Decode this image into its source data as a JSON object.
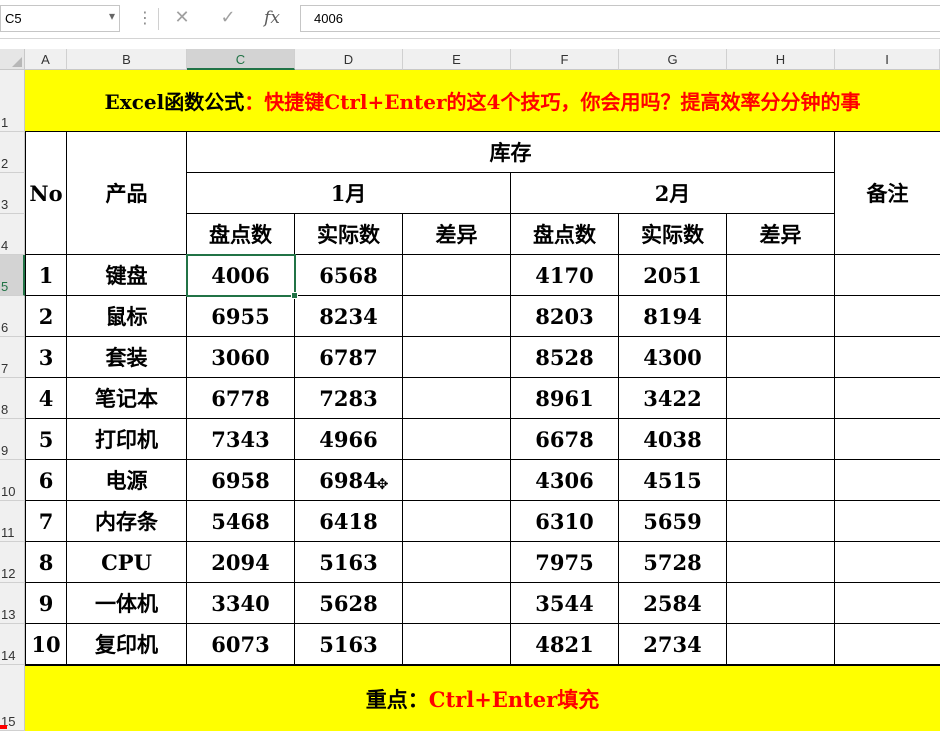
{
  "formula_bar": {
    "name_box": "C5",
    "cancel_icon": "✕",
    "confirm_icon": "✓",
    "fx_label": "fx",
    "formula_value": "4006"
  },
  "columns": [
    "A",
    "B",
    "C",
    "D",
    "E",
    "F",
    "G",
    "H",
    "I"
  ],
  "rows": [
    "1",
    "2",
    "3",
    "4",
    "5",
    "6",
    "7",
    "8",
    "9",
    "10",
    "11",
    "12",
    "13",
    "14",
    "15"
  ],
  "selected_column": "C",
  "selected_row": "5",
  "sheet": {
    "title_black": "Excel函数公式",
    "title_red": "：快捷键Ctrl+Enter的这4个技巧，你会用吗？提高效率分分钟的事",
    "header": {
      "no": "No",
      "product": "产品",
      "stock": "库存",
      "month1": "1月",
      "month2": "2月",
      "remark": "备注",
      "count": "盘点数",
      "actual": "实际数",
      "diff": "差异"
    },
    "records": [
      {
        "no": "1",
        "product": "键盘",
        "c1": "4006",
        "a1": "6568",
        "c2": "4170",
        "a2": "2051"
      },
      {
        "no": "2",
        "product": "鼠标",
        "c1": "6955",
        "a1": "8234",
        "c2": "8203",
        "a2": "8194"
      },
      {
        "no": "3",
        "product": "套装",
        "c1": "3060",
        "a1": "6787",
        "c2": "8528",
        "a2": "4300"
      },
      {
        "no": "4",
        "product": "笔记本",
        "c1": "6778",
        "a1": "7283",
        "c2": "8961",
        "a2": "3422"
      },
      {
        "no": "5",
        "product": "打印机",
        "c1": "7343",
        "a1": "4966",
        "c2": "6678",
        "a2": "4038"
      },
      {
        "no": "6",
        "product": "电源",
        "c1": "6958",
        "a1": "6984",
        "c2": "4306",
        "a2": "4515"
      },
      {
        "no": "7",
        "product": "内存条",
        "c1": "5468",
        "a1": "6418",
        "c2": "6310",
        "a2": "5659"
      },
      {
        "no": "8",
        "product": "CPU",
        "c1": "2094",
        "a1": "5163",
        "c2": "7975",
        "a2": "5728"
      },
      {
        "no": "9",
        "product": "一体机",
        "c1": "3340",
        "a1": "5628",
        "c2": "3544",
        "a2": "2584"
      },
      {
        "no": "10",
        "product": "复印机",
        "c1": "6073",
        "a1": "5163",
        "c2": "4821",
        "a2": "2734"
      }
    ],
    "footer_black": "重点：",
    "footer_red": "Ctrl+Enter填充"
  },
  "colors": {
    "highlight": "#ffff00",
    "accent_red": "#ff0000",
    "selection_green": "#217346"
  }
}
